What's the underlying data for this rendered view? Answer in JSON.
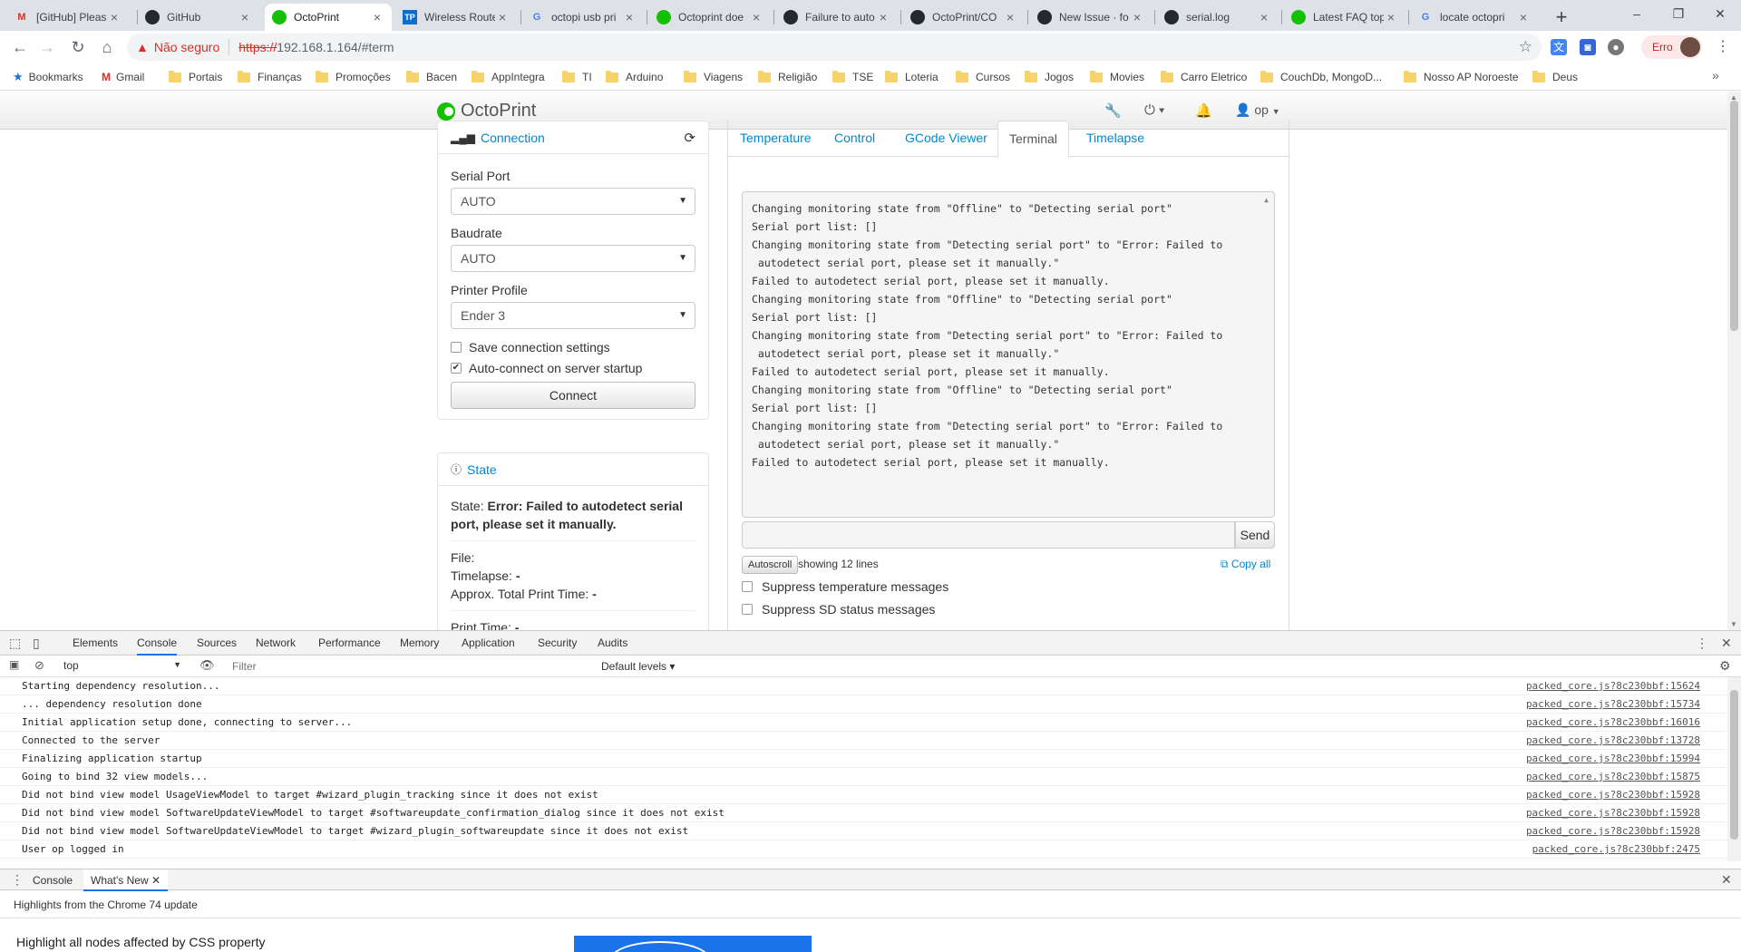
{
  "browser": {
    "tabs": [
      {
        "icon": "gmail-icon",
        "title": "[GitHub] Pleas",
        "active": false
      },
      {
        "icon": "github-icon",
        "title": "GitHub",
        "active": false
      },
      {
        "icon": "octoprint-icon",
        "title": "OctoPrint",
        "active": true
      },
      {
        "icon": "tplink-icon",
        "title": "Wireless Route",
        "active": false
      },
      {
        "icon": "google-icon",
        "title": "octopi usb pri",
        "active": false
      },
      {
        "icon": "octoprint-icon",
        "title": "Octoprint doe",
        "active": false
      },
      {
        "icon": "github-icon",
        "title": "Failure to auto",
        "active": false
      },
      {
        "icon": "github-icon",
        "title": "OctoPrint/CO",
        "active": false
      },
      {
        "icon": "github-icon",
        "title": "New Issue · fo",
        "active": false
      },
      {
        "icon": "github-icon",
        "title": "serial.log",
        "active": false
      },
      {
        "icon": "octoprint-icon",
        "title": "Latest FAQ top",
        "active": false
      },
      {
        "icon": "google-icon",
        "title": "locate octopri",
        "active": false
      }
    ],
    "new_tab_label": "+",
    "address": {
      "security_label": "Não seguro",
      "scheme": "https://",
      "host_path": "192.168.1.164/#term"
    },
    "profile_label": "Erro",
    "bookmarks": [
      "Bookmarks",
      "Gmail",
      "Portais",
      "Finanças",
      "Promoções",
      "Bacen",
      "AppIntegra",
      "TI",
      "Arduino",
      "Viagens",
      "Religião",
      "TSE",
      "Loteria",
      "Cursos",
      "Jogos",
      "Movies",
      "Carro Eletrico",
      "CouchDb, MongoD...",
      "Nosso AP Noroeste",
      "Deus"
    ],
    "bookmarks_more": "»"
  },
  "octoprint": {
    "brand": "OctoPrint",
    "user": "op",
    "connection": {
      "title": "Connection",
      "serial_port_label": "Serial Port",
      "serial_port_value": "AUTO",
      "baudrate_label": "Baudrate",
      "baudrate_value": "AUTO",
      "profile_label": "Printer Profile",
      "profile_value": "Ender 3",
      "save_settings_label": "Save connection settings",
      "save_settings_checked": false,
      "autoconnect_label": "Auto-connect on server startup",
      "autoconnect_checked": true,
      "connect_button": "Connect"
    },
    "state": {
      "title": "State",
      "state_label": "State:",
      "state_value": "Error: Failed to autodetect serial port, please set it manually.",
      "file_label": "File:",
      "timelapse_label": "Timelapse:",
      "timelapse_value": "-",
      "approx_label": "Approx. Total Print Time:",
      "approx_value": "-",
      "print_time_label": "Print Time:",
      "print_time_value": "-"
    },
    "tabs": [
      "Temperature",
      "Control",
      "GCode Viewer",
      "Terminal",
      "Timelapse"
    ],
    "active_tab": "Terminal",
    "terminal": {
      "lines": [
        "Changing monitoring state from \"Offline\" to \"Detecting serial port\"",
        "Serial port list: []",
        "Changing monitoring state from \"Detecting serial port\" to \"Error: Failed to",
        " autodetect serial port, please set it manually.\"",
        "Failed to autodetect serial port, please set it manually.",
        "Changing monitoring state from \"Offline\" to \"Detecting serial port\"",
        "Serial port list: []",
        "Changing monitoring state from \"Detecting serial port\" to \"Error: Failed to",
        " autodetect serial port, please set it manually.\"",
        "Failed to autodetect serial port, please set it manually.",
        "Changing monitoring state from \"Offline\" to \"Detecting serial port\"",
        "Serial port list: []",
        "Changing monitoring state from \"Detecting serial port\" to \"Error: Failed to",
        " autodetect serial port, please set it manually.\"",
        "Failed to autodetect serial port, please set it manually."
      ],
      "send_button": "Send",
      "autoscroll_button": "Autoscroll",
      "showing_text": "showing 12 lines",
      "copy_all": "Copy all",
      "suppress_temp_label": "Suppress temperature messages",
      "suppress_sd_label": "Suppress SD status messages"
    }
  },
  "devtools": {
    "tabs": [
      "Elements",
      "Console",
      "Sources",
      "Network",
      "Performance",
      "Memory",
      "Application",
      "Security",
      "Audits"
    ],
    "active_tab": "Console",
    "context": "top",
    "filter_placeholder": "Filter",
    "levels": "Default levels ▾",
    "console_rows": [
      {
        "msg": "Starting dependency resolution...",
        "src": "packed_core.js?8c230bbf:15624"
      },
      {
        "msg": "... dependency resolution done",
        "src": "packed_core.js?8c230bbf:15734"
      },
      {
        "msg": "Initial application setup done, connecting to server...",
        "src": "packed_core.js?8c230bbf:16016"
      },
      {
        "msg": "Connected to the server",
        "src": "packed_core.js?8c230bbf:13728"
      },
      {
        "msg": "Finalizing application startup",
        "src": "packed_core.js?8c230bbf:15994"
      },
      {
        "msg": "Going to bind 32 view models...",
        "src": "packed_core.js?8c230bbf:15875"
      },
      {
        "msg": "Did not bind view model UsageViewModel to target #wizard_plugin_tracking since it does not exist",
        "src": "packed_core.js?8c230bbf:15928"
      },
      {
        "msg": "Did not bind view model SoftwareUpdateViewModel to target #softwareupdate_confirmation_dialog since it does not exist",
        "src": "packed_core.js?8c230bbf:15928"
      },
      {
        "msg": "Did not bind view model SoftwareUpdateViewModel to target #wizard_plugin_softwareupdate since it does not exist",
        "src": "packed_core.js?8c230bbf:15928"
      },
      {
        "msg": "User op logged in",
        "src": "packed_core.js?8c230bbf:2475"
      }
    ],
    "drawer_tabs": [
      "Console",
      "What's New"
    ],
    "drawer_active": "What's New",
    "whats_new_heading": "Highlights from the Chrome 74 update",
    "whats_new_item": "Highlight all nodes affected by CSS property"
  }
}
